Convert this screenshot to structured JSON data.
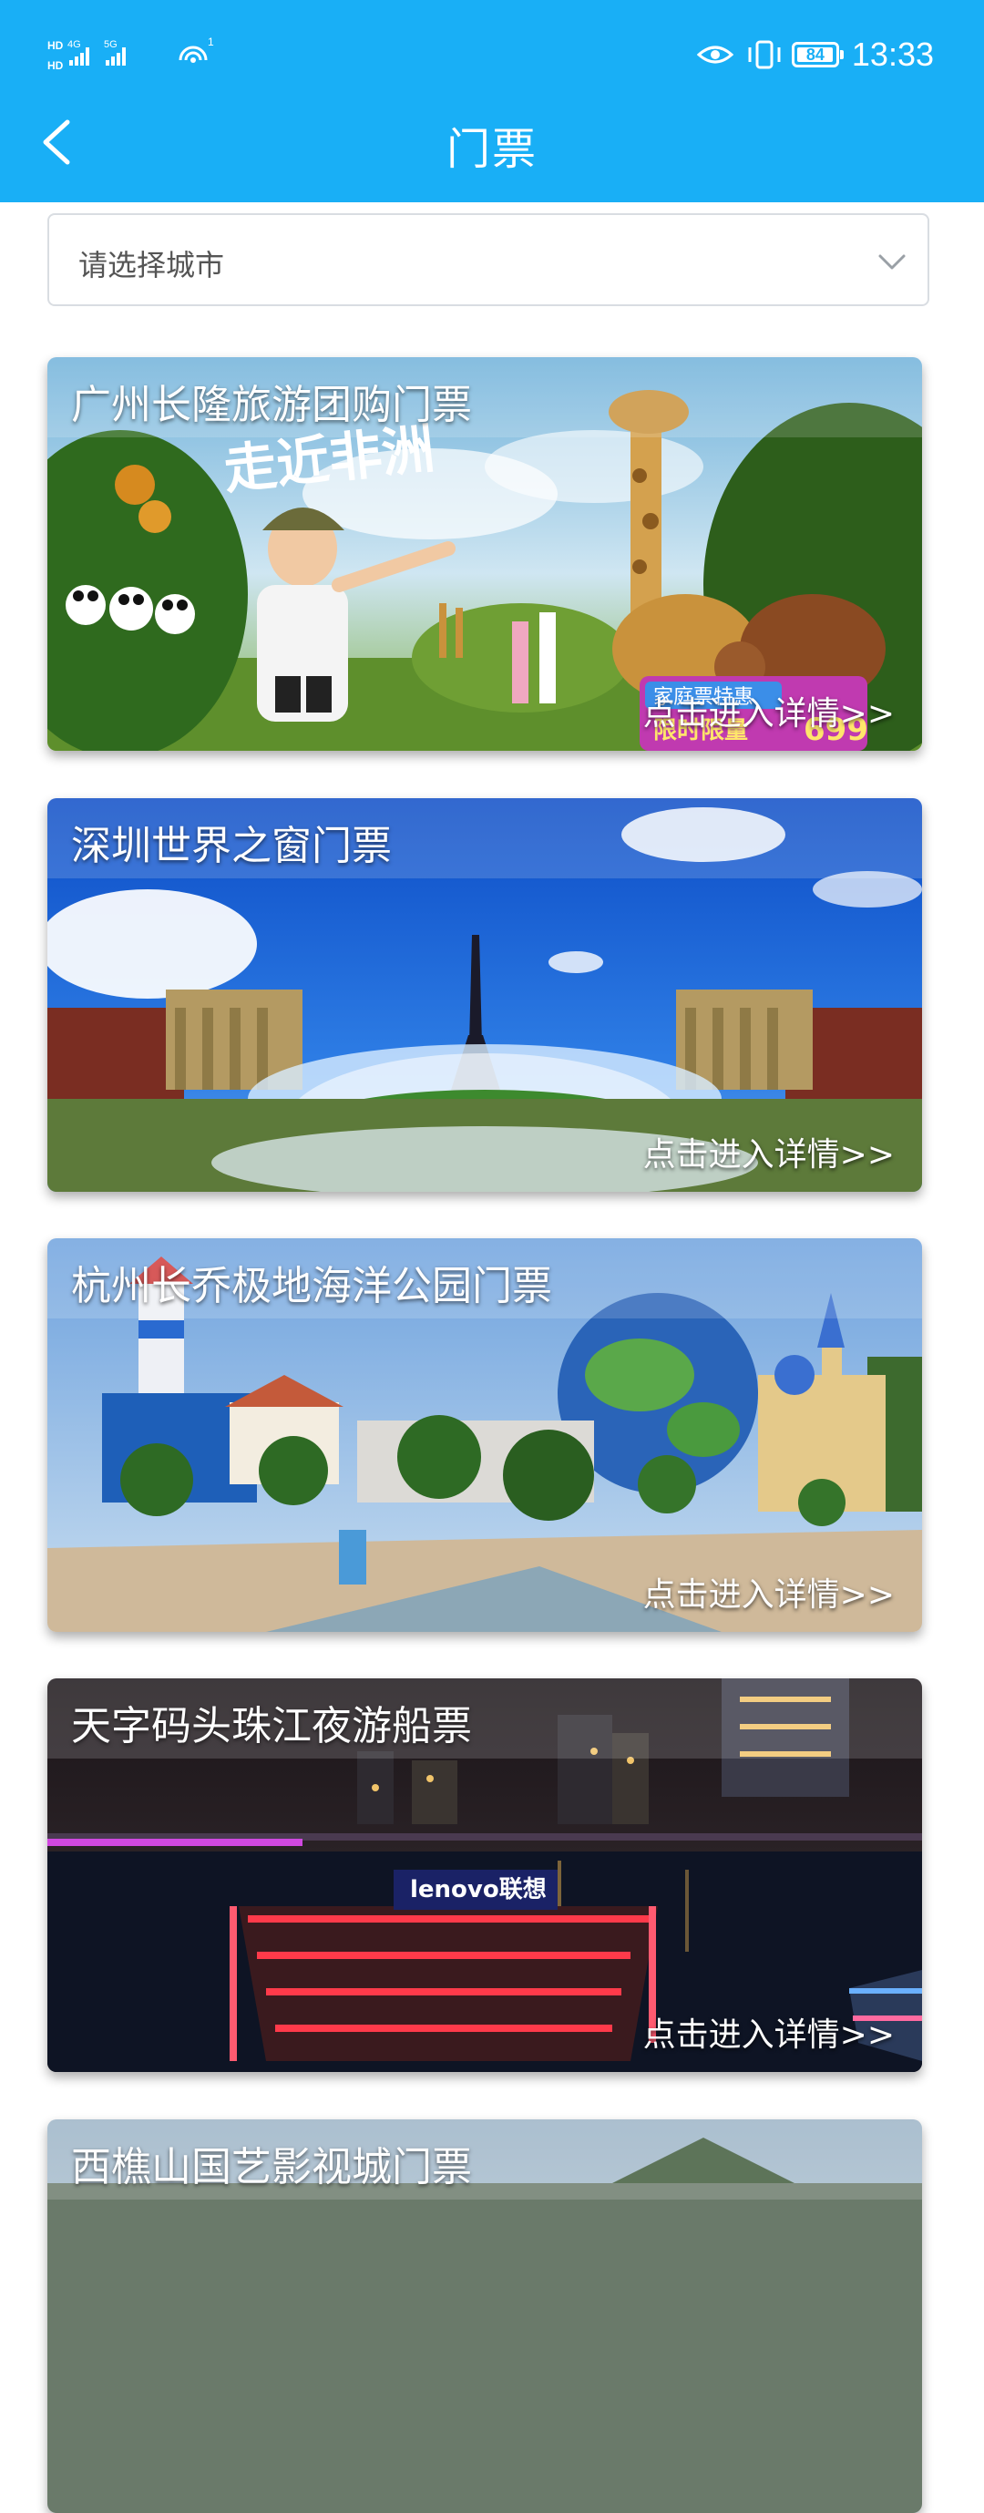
{
  "status_bar": {
    "network_1": "4G",
    "network_2": "5G",
    "hotspot_count": "1",
    "battery": "84",
    "time": "13:33"
  },
  "header": {
    "title": "门票",
    "back_icon": "chevron-left-icon"
  },
  "city_select": {
    "placeholder": "请选择城市",
    "icon": "chevron-down-icon"
  },
  "tickets": [
    {
      "title": "广州长隆旅游团购门票",
      "link_text": "点击进入详情>>",
      "scene_text": "走近非洲",
      "promo_line1": "家庭票特惠",
      "promo_line2": "限时限量",
      "promo_price": "699"
    },
    {
      "title": "深圳世界之窗门票",
      "link_text": "点击进入详情>>"
    },
    {
      "title": "杭州长乔极地海洋公园门票",
      "link_text": "点击进入详情>>"
    },
    {
      "title": "天字码头珠江夜游船票",
      "link_text": "点击进入详情>>",
      "scene_text": "lenovo联想"
    },
    {
      "title": "西樵山国艺影视城门票"
    }
  ],
  "colors": {
    "header_bg": "#19aff6",
    "card_link": "#ffffff",
    "border": "#d9dde2"
  }
}
